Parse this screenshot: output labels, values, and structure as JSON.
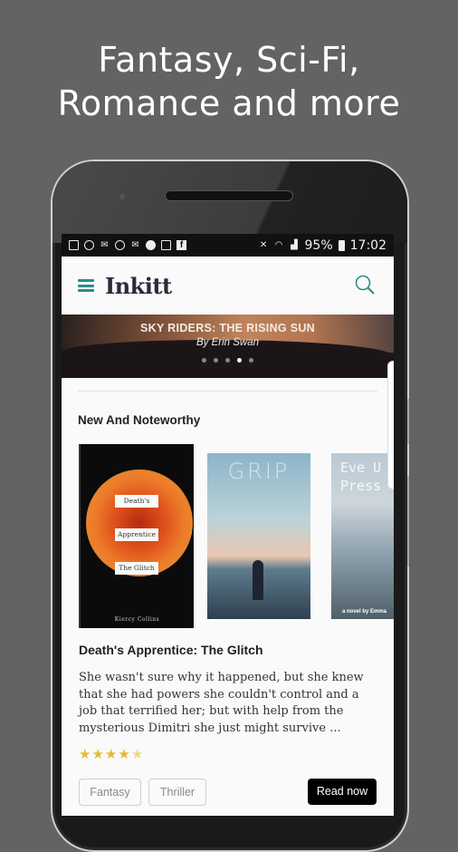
{
  "headline": {
    "line1": "Fantasy, Sci-Fi,",
    "line2": "Romance and more"
  },
  "statusbar": {
    "left_icons": [
      "gallery-icon",
      "circle-icon",
      "email-icon",
      "chrome-icon",
      "mail-open-icon",
      "messenger-icon",
      "instagram-icon",
      "facebook-icon"
    ],
    "right_icons": [
      "mute-icon",
      "wifi-icon",
      "signal-icon"
    ],
    "battery": "95%",
    "time": "17:02"
  },
  "appbar": {
    "logo": "Inkitt",
    "accent_color": "#2e8b8b"
  },
  "hero": {
    "title": "SKY RIDERS: THE RISING SUN",
    "author": "By Erin Swan",
    "dots_total": 5,
    "active_dot": 4
  },
  "section": {
    "title": "New And Noteworthy"
  },
  "covers": [
    {
      "label1": "Death's",
      "label2": "Apprentice",
      "label3": "The Glitch",
      "author": "Kiercy Collins"
    },
    {
      "title": "GRIP"
    },
    {
      "title_line1": "Eve U",
      "title_line2": "Press",
      "byline": "a novel by Emma"
    }
  ],
  "book": {
    "title": "Death's Apprentice: The Glitch",
    "description": "She wasn't sure why it happened, but she knew that she had powers she couldn't control and a job that terrified her; but with help from the mysterious Dimitri she just might survive ...",
    "rating": 4.5,
    "rating_max": 5,
    "tags": [
      "Fantasy",
      "Thriller"
    ],
    "read_button": "Read now"
  }
}
